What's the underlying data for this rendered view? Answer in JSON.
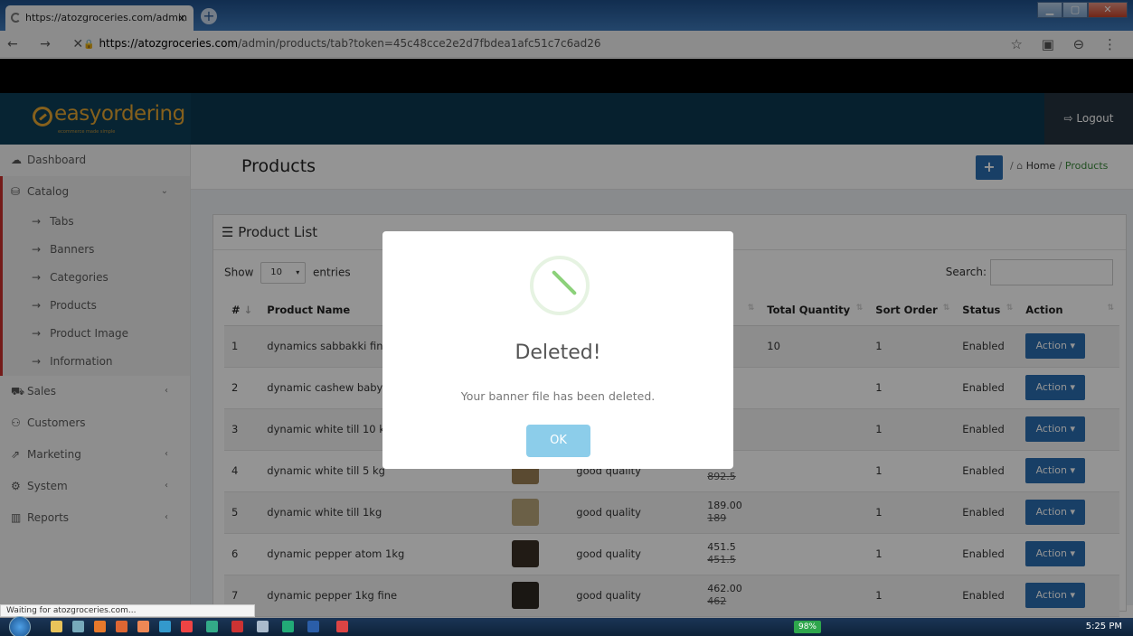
{
  "browser": {
    "tab_title": "https://atozgroceries.com/admin",
    "tab_close": "×",
    "new_tab": "+",
    "nav_buttons": "← → ✕",
    "url_host": "https://atozgroceries.com",
    "url_path": "/admin/products/tab?token=45c48cce2e2d7fbdea1afc51c7c6ad26",
    "right_icons": "☆ ▣ ⊖ ⋮",
    "status_text": "Waiting for atozgroceries.com..."
  },
  "header": {
    "logo_text": "easyordering",
    "logo_sub": "ecommerce made simple",
    "logout_label": "⇨ Logout"
  },
  "sidebar": {
    "items": [
      {
        "icon": "☁",
        "label": "Dashboard"
      },
      {
        "icon": "⛁",
        "label": "Catalog",
        "chev": "⌄"
      },
      {
        "icon": "⛟",
        "label": "Sales",
        "chev": "‹"
      },
      {
        "icon": "⚇",
        "label": "Customers"
      },
      {
        "icon": "⇗",
        "label": "Marketing",
        "chev": "‹"
      },
      {
        "icon": "⚙",
        "label": "System",
        "chev": "‹"
      },
      {
        "icon": "▥",
        "label": "Reports",
        "chev": "‹"
      }
    ],
    "catalog_sub": [
      "Tabs",
      "Banners",
      "Categories",
      "Products",
      "Product Image",
      "Information"
    ]
  },
  "page": {
    "title": "Products",
    "add_button": "+",
    "breadcrumb_sep": "/",
    "breadcrumb_home": "Home",
    "breadcrumb_current": "Products"
  },
  "panel": {
    "title": "Product List",
    "show_label": "Show",
    "entries_value": "10",
    "entries_label": "entries",
    "search_label": "Search:"
  },
  "table": {
    "headers": [
      "#",
      "Product Name",
      "",
      "",
      "",
      "Total Quantity",
      "Sort Order",
      "Status",
      "Action"
    ],
    "rows": [
      {
        "num": "1",
        "name": "dynamics sabbakki fine",
        "desc": "",
        "price": "",
        "old": "",
        "qty": "10",
        "sort": "1",
        "status": "Enabled",
        "action": "Action ▾"
      },
      {
        "num": "2",
        "name": "dynamic cashew baby",
        "desc": "",
        "price": "",
        "old": "",
        "qty": "",
        "sort": "1",
        "status": "Enabled",
        "action": "Action ▾"
      },
      {
        "num": "3",
        "name": "dynamic white till 10 kg",
        "desc": "",
        "price": "",
        "old": "",
        "qty": "",
        "sort": "1",
        "status": "Enabled",
        "action": "Action ▾"
      },
      {
        "num": "4",
        "name": "dynamic white till 5 kg",
        "desc": "good quality",
        "price": "",
        "old": "892.5",
        "qty": "",
        "sort": "1",
        "status": "Enabled",
        "action": "Action ▾"
      },
      {
        "num": "5",
        "name": "dynamic white till 1kg",
        "desc": "good quality",
        "price": "189.00",
        "old": "189",
        "qty": "",
        "sort": "1",
        "status": "Enabled",
        "action": "Action ▾"
      },
      {
        "num": "6",
        "name": "dynamic pepper atom 1kg",
        "desc": "good quality",
        "price": "451.5",
        "old": "451.5",
        "qty": "",
        "sort": "1",
        "status": "Enabled",
        "action": "Action ▾"
      },
      {
        "num": "7",
        "name": "dynamic pepper 1kg fine",
        "desc": "good quality",
        "price": "462.00",
        "old": "462",
        "qty": "",
        "sort": "1",
        "status": "Enabled",
        "action": "Action ▾"
      }
    ]
  },
  "modal": {
    "title": "Deleted!",
    "message": "Your banner file has been deleted.",
    "ok_label": "OK"
  },
  "taskbar": {
    "battery": "98%",
    "clock": "5:25 PM"
  },
  "colors": {
    "header_bg": "#0b3750",
    "logo_accent": "#e6a531",
    "action_blue": "#2a6db0",
    "ok_button": "#8ccdea",
    "breadcrumb_green": "#3c8a3c"
  }
}
